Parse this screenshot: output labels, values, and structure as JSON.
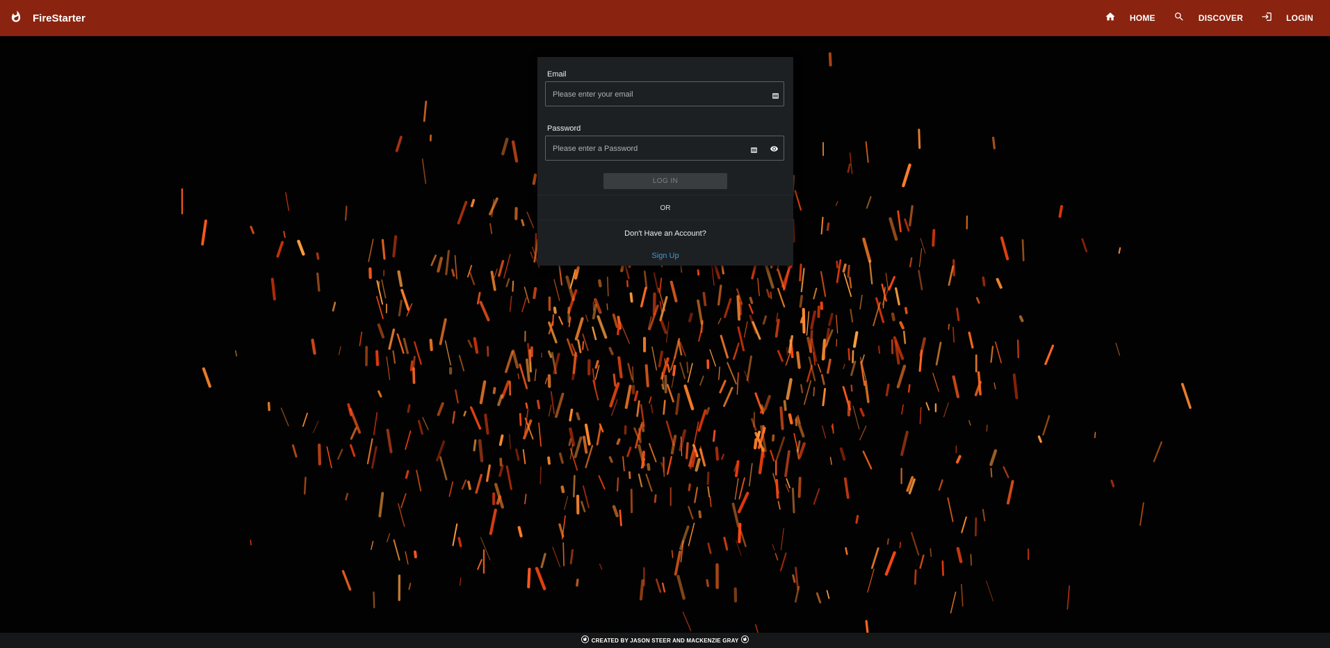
{
  "app": {
    "title": "FireStarter",
    "logo_icon": "flame-icon"
  },
  "nav": [
    {
      "label": "HOME",
      "icon": "home-icon"
    },
    {
      "label": "DISCOVER",
      "icon": "search-icon"
    },
    {
      "label": "LOGIN",
      "icon": "login-icon"
    }
  ],
  "form": {
    "email_label": "Email",
    "email_placeholder": "Please enter your email",
    "email_value": "",
    "password_label": "Password",
    "password_placeholder": "Please enter a Password",
    "password_value": "",
    "login_button": "LOG IN",
    "or_text": "OR",
    "no_account_text": "Don't Have an Account?",
    "signup_link": "Sign Up"
  },
  "footer": {
    "text": "CREATED BY JASON STEER AND MACKENZIE GRAY"
  },
  "colors": {
    "header": "#8a2310",
    "card": "#1d2023",
    "link": "#3b9bd6",
    "spark": "#ff5a1f"
  }
}
